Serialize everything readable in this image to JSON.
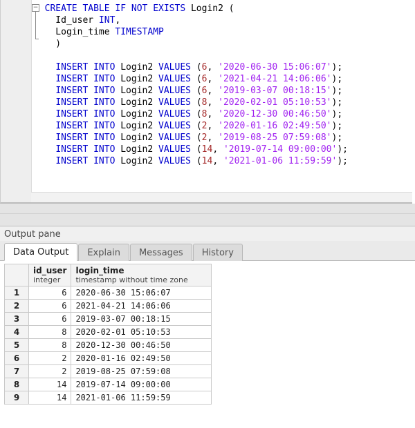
{
  "chart_data": {
    "type": "table",
    "columns": [
      "id_user",
      "login_time"
    ],
    "column_types": [
      "integer",
      "timestamp without time zone"
    ],
    "rows": [
      [
        6,
        "2020-06-30 15:06:07"
      ],
      [
        6,
        "2021-04-21 14:06:06"
      ],
      [
        6,
        "2019-03-07 00:18:15"
      ],
      [
        8,
        "2020-02-01 05:10:53"
      ],
      [
        8,
        "2020-12-30 00:46:50"
      ],
      [
        2,
        "2020-01-16 02:49:50"
      ],
      [
        2,
        "2019-08-25 07:59:08"
      ],
      [
        14,
        "2019-07-14 09:00:00"
      ],
      [
        14,
        "2021-01-06 11:59:59"
      ]
    ]
  },
  "sql": {
    "create_tokens": [
      [
        "kw",
        "CREATE TABLE IF NOT EXISTS"
      ],
      [
        "id",
        " Login2 "
      ],
      [
        "id",
        "("
      ]
    ],
    "col1_tokens": [
      [
        "id",
        "  Id_user "
      ],
      [
        "type",
        "INT"
      ],
      [
        "id",
        ","
      ]
    ],
    "col2_tokens": [
      [
        "id",
        "  Login_time "
      ],
      [
        "type",
        "TIMESTAMP"
      ]
    ],
    "close_tokens": [
      [
        "id",
        "  )"
      ]
    ],
    "inserts": [
      {
        "id": "6",
        "ts": "'2020-06-30 15:06:07'"
      },
      {
        "id": "6",
        "ts": "'2021-04-21 14:06:06'"
      },
      {
        "id": "6",
        "ts": "'2019-03-07 00:18:15'"
      },
      {
        "id": "8",
        "ts": "'2020-02-01 05:10:53'"
      },
      {
        "id": "8",
        "ts": "'2020-12-30 00:46:50'"
      },
      {
        "id": "2",
        "ts": "'2020-01-16 02:49:50'"
      },
      {
        "id": "2",
        "ts": "'2019-08-25 07:59:08'"
      },
      {
        "id": "14",
        "ts": "'2019-07-14 09:00:00'"
      },
      {
        "id": "14",
        "ts": "'2021-01-06 11:59:59'"
      }
    ],
    "insert_kw_a": "INSERT INTO",
    "insert_mid": " Login2 ",
    "insert_kw_b": "VALUES",
    "insert_open": " (",
    "insert_sep": ", ",
    "insert_close": ");"
  },
  "output_pane_label": "Output pane",
  "tabs": {
    "data_output": "Data Output",
    "explain": "Explain",
    "messages": "Messages",
    "history": "History"
  },
  "grid": {
    "col1_head": "id_user",
    "col1_sub": "integer",
    "col2_head": "login_time",
    "col2_sub": "timestamp without time zone"
  },
  "fold_glyph": "−"
}
